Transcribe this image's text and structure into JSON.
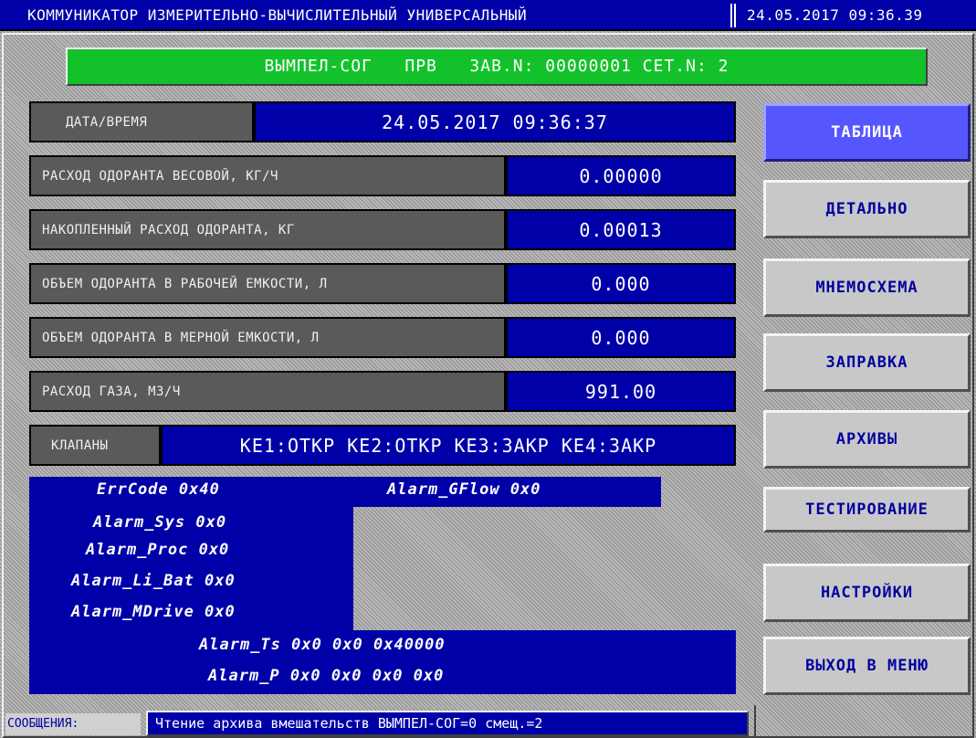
{
  "titlebar": {
    "title": "КОММУНИКАТОР ИЗМЕРИТЕЛЬНО-ВЫЧИСЛИТЕЛЬНЫЙ УНИВЕРСАЛЬНЫЙ",
    "datetime": "24.05.2017 09:36.39"
  },
  "header": {
    "text": "ВЫМПЕЛ-СОГ   ПРВ   ЗАВ.N: 00000001 СЕТ.N: 2"
  },
  "rows": {
    "datetime": {
      "label": "ДАТА/ВРЕМЯ",
      "value": "24.05.2017 09:36:37"
    },
    "odorant_mass_flow": {
      "label": "РАСХОД ОДОРАНТА ВЕСОВОЙ, КГ/Ч",
      "value": "0.00000"
    },
    "odorant_accumulated": {
      "label": "НАКОПЛЕННЫЙ РАСХОД ОДОРАНТА, КГ",
      "value": "0.00013"
    },
    "odorant_work_tank": {
      "label": "ОБЪЕМ ОДОРАНТА В РАБОЧЕЙ ЕМКОСТИ, Л",
      "value": "0.000"
    },
    "odorant_measure_tank": {
      "label": "ОБЪЕМ ОДОРАНТА В МЕРНОЙ ЕМКОСТИ, Л",
      "value": "0.000"
    },
    "gas_flow": {
      "label": "РАСХОД ГАЗА, М3/Ч",
      "value": "991.00"
    },
    "valves": {
      "label": "КЛАПАНЫ",
      "value": "КЕ1:ОТКР КЕ2:ОТКР КЕ3:ЗАКР КЕ4:ЗАКР"
    }
  },
  "alarms": {
    "errcode": "ErrCode 0x40",
    "gflow": "Alarm_GFlow 0x0",
    "sys": "Alarm_Sys 0x0",
    "proc": "Alarm_Proc 0x0",
    "libat": "Alarm_Li_Bat 0x0",
    "mdrive": "Alarm_MDrive 0x0",
    "ts": "Alarm_Ts 0x0 0x0 0x40000",
    "p": "Alarm_P 0x0 0x0 0x0 0x0"
  },
  "menu": {
    "table": "ТАБЛИЦА",
    "detail": "ДЕТАЛЬНО",
    "mnemo": "МНЕМОСХЕМА",
    "refuel": "ЗАПРАВКА",
    "archives": "АРХИВЫ",
    "testing": "ТЕСТИРОВАНИЕ",
    "settings": "НАСТРОЙКИ",
    "exit": "ВЫХОД В МЕНЮ",
    "active": "table"
  },
  "messages": {
    "label": "СООБЩЕНИЯ:",
    "text": "Чтение архива вмешательств ВЫМПЕЛ-СОГ=0 смещ.=2"
  },
  "colors": {
    "panel_blue": "#0000a8",
    "header_green": "#13c22b",
    "label_gray": "#5a5a5a",
    "active_button": "#5656ff"
  }
}
